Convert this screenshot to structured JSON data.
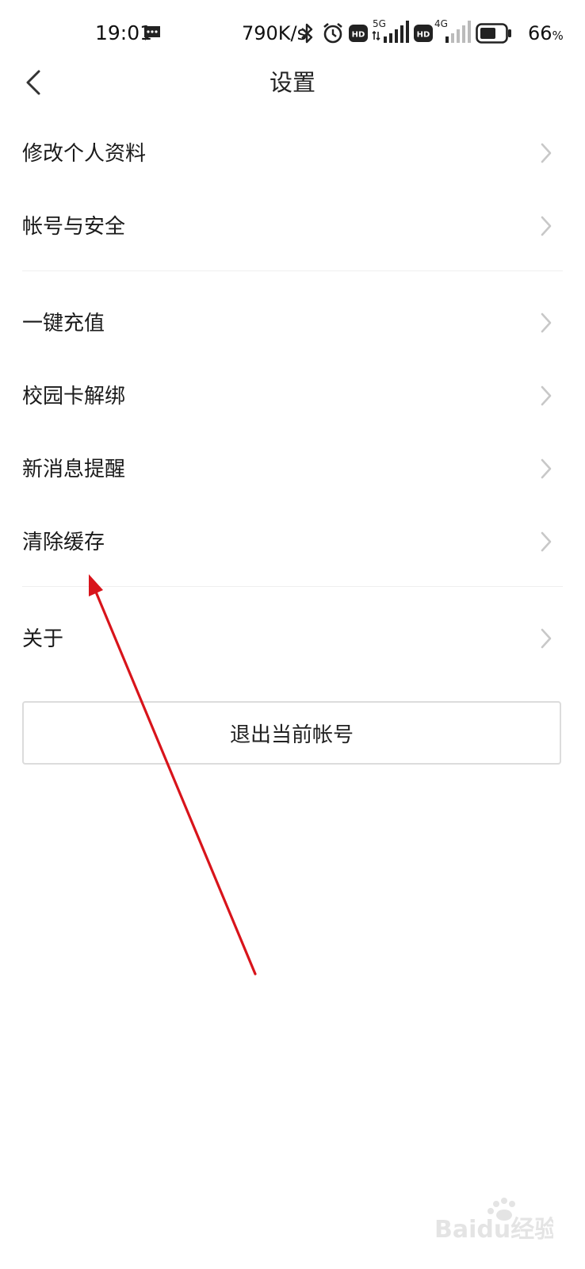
{
  "status_bar": {
    "time": "19:01",
    "net_speed": "790K/s",
    "battery_percent": "66",
    "battery_unit": "%",
    "battery_level": 0.66,
    "sim1_label": "5G",
    "sim2_label": "4G",
    "hd_label": "HD",
    "icons": [
      "message-icon",
      "bluetooth-icon",
      "alarm-icon",
      "hd-icon",
      "signal-5g-icon",
      "hd-icon",
      "signal-4g-icon",
      "battery-icon"
    ]
  },
  "header": {
    "title": "设置",
    "back_icon": "chevron-left-icon"
  },
  "menu": {
    "items": [
      {
        "label": "修改个人资料"
      },
      {
        "label": "帐号与安全"
      },
      {
        "label": "一键充值"
      },
      {
        "label": "校园卡解绑"
      },
      {
        "label": "新消息提醒"
      },
      {
        "label": "清除缓存"
      },
      {
        "label": "关于"
      }
    ],
    "chevron_icon": "chevron-right-icon"
  },
  "logout": {
    "label": "退出当前帐号"
  },
  "colors": {
    "annotation_arrow": "#e0191e",
    "chevron": "#c8c8c8",
    "divider": "#efefef",
    "button_border": "#dcdcdc"
  },
  "watermark": {
    "text": "Baidu经验"
  }
}
